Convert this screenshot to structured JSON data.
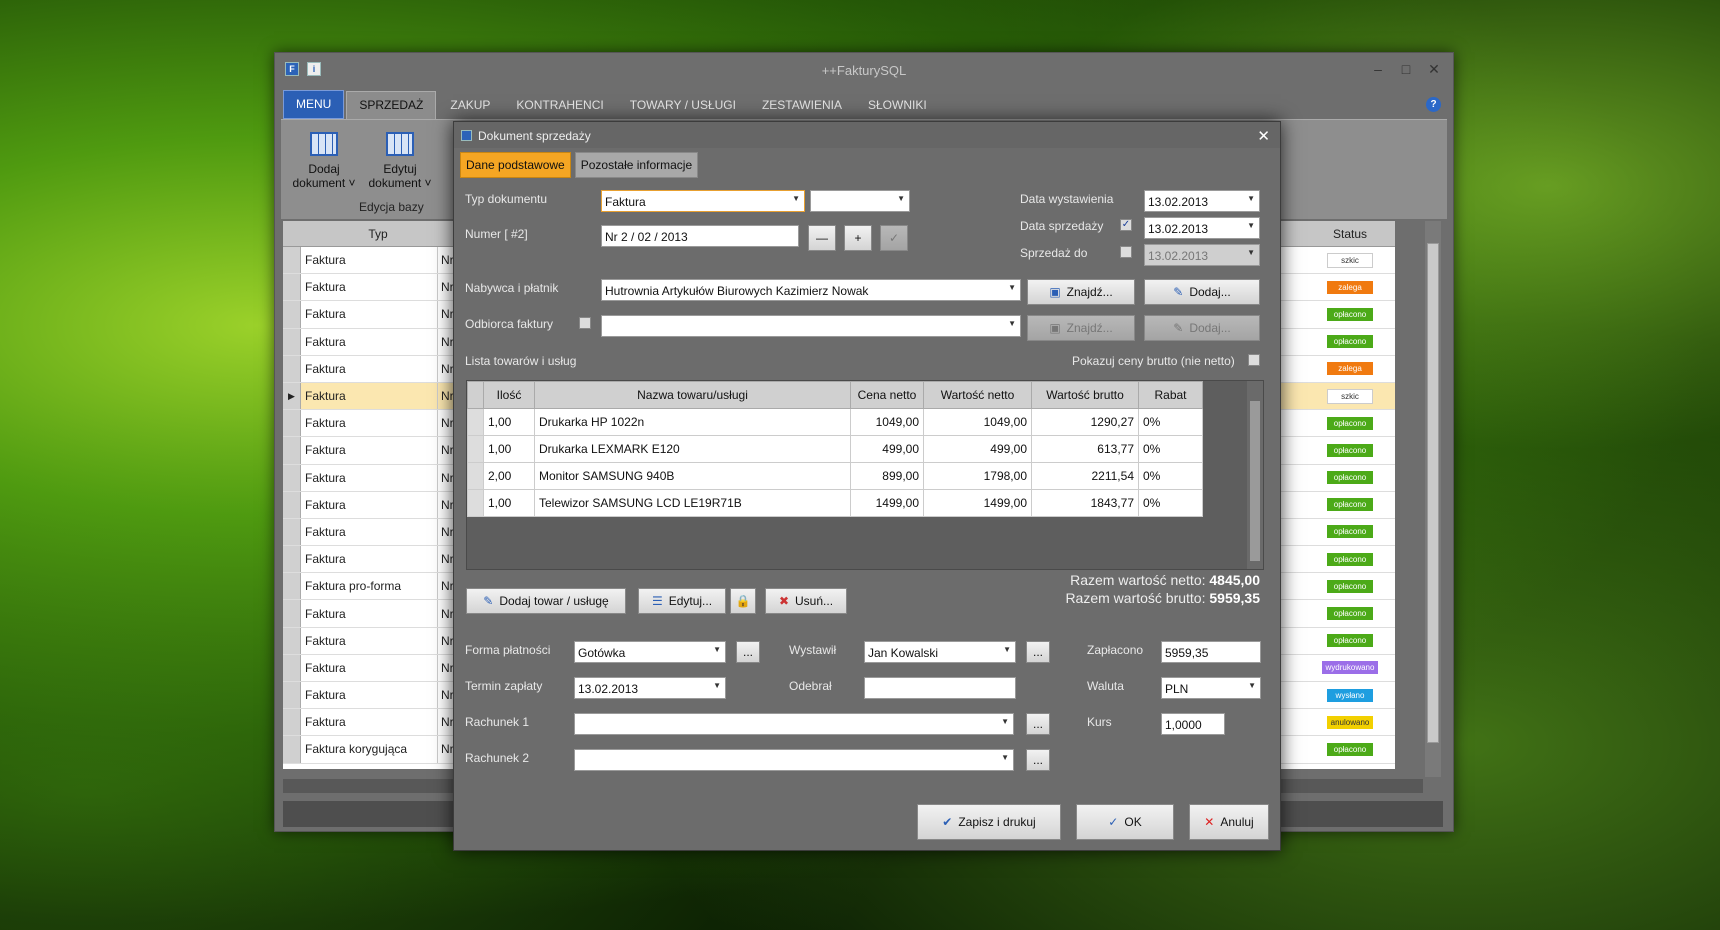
{
  "app": {
    "title": "++FakturySQL"
  },
  "menu": {
    "items": [
      "MENU",
      "SPRZEDAŻ",
      "ZAKUP",
      "KONTRAHENCI",
      "TOWARY / USŁUGI",
      "ZESTAWIENIA",
      "SŁOWNIKI"
    ]
  },
  "ribbon": {
    "add_doc": "Dodaj\ndokument",
    "edit_doc": "Edytuj\ndokument",
    "group": "Edycja bazy"
  },
  "grid": {
    "col_typ": "Typ",
    "col_status": "Status",
    "rows": [
      {
        "typ": "Faktura",
        "nr": "Nr",
        "status": "szkic",
        "color": "#ffffff"
      },
      {
        "typ": "Faktura",
        "nr": "Nr",
        "status": "zalega",
        "color": "#f07a10"
      },
      {
        "typ": "Faktura",
        "nr": "Nr",
        "status": "opłacono",
        "color": "#4caa18"
      },
      {
        "typ": "Faktura",
        "nr": "Nr",
        "status": "opłacono",
        "color": "#4caa18"
      },
      {
        "typ": "Faktura",
        "nr": "Nr",
        "status": "zalega",
        "color": "#f07a10"
      },
      {
        "typ": "Faktura",
        "nr": "Nr",
        "status": "szkic",
        "color": "#ffffff"
      },
      {
        "typ": "Faktura",
        "nr": "Nr",
        "status": "opłacono",
        "color": "#4caa18"
      },
      {
        "typ": "Faktura",
        "nr": "Nr",
        "status": "opłacono",
        "color": "#4caa18"
      },
      {
        "typ": "Faktura",
        "nr": "Nr",
        "status": "opłacono",
        "color": "#4caa18"
      },
      {
        "typ": "Faktura",
        "nr": "Nr",
        "status": "opłacono",
        "color": "#4caa18"
      },
      {
        "typ": "Faktura",
        "nr": "Nr",
        "status": "opłacono",
        "color": "#4caa18"
      },
      {
        "typ": "Faktura",
        "nr": "Nr",
        "status": "opłacono",
        "color": "#4caa18"
      },
      {
        "typ": "Faktura pro-forma",
        "nr": "Nr",
        "status": "opłacono",
        "color": "#4caa18"
      },
      {
        "typ": "Faktura",
        "nr": "Nr",
        "status": "opłacono",
        "color": "#4caa18"
      },
      {
        "typ": "Faktura",
        "nr": "Nr",
        "status": "opłacono",
        "color": "#4caa18"
      },
      {
        "typ": "Faktura",
        "nr": "Nr",
        "status": "wydrukowano",
        "color": "#9b6ee8"
      },
      {
        "typ": "Faktura",
        "nr": "Nr",
        "status": "wysłano",
        "color": "#1e9ee0"
      },
      {
        "typ": "Faktura",
        "nr": "Nr",
        "status": "anulowano",
        "color": "#f2d000"
      },
      {
        "typ": "Faktura korygująca",
        "nr": "Nr",
        "status": "opłacono",
        "color": "#4caa18"
      }
    ]
  },
  "dialog": {
    "title": "Dokument sprzedaży",
    "tabs": [
      "Dane podstawowe",
      "Pozostałe informacje"
    ],
    "typ_label": "Typ dokumentu",
    "typ_value": "Faktura",
    "numer_label": "Numer [ #2]",
    "numer_value": "Nr 2 / 02 / 2013",
    "data_wyst_label": "Data wystawienia",
    "data_wyst": "13.02.2013",
    "data_sprz_label": "Data sprzedaży",
    "data_sprz": "13.02.2013",
    "sprz_do_label": "Sprzedaż do",
    "sprz_do": "13.02.2013",
    "nabywca_label": "Nabywca i płatnik",
    "nabywca": "Hutrownia Artykułów Biurowych Kazimierz Nowak",
    "odbiorca_label": "Odbiorca faktury",
    "znajdz": "Znajdź...",
    "dodaj": "Dodaj...",
    "lista_label": "Lista towarów i usług",
    "brutto_label": "Pokazuj ceny brutto (nie netto)",
    "cols": [
      "Ilość",
      "Nazwa towaru/usługi",
      "Cena netto",
      "Wartość netto",
      "Wartość brutto",
      "Rabat"
    ],
    "items": [
      [
        "1,00",
        "Drukarka HP 1022n",
        "1049,00",
        "1049,00",
        "1290,27",
        "0%"
      ],
      [
        "1,00",
        "Drukarka LEXMARK E120",
        "499,00",
        "499,00",
        "613,77",
        "0%"
      ],
      [
        "2,00",
        "Monitor SAMSUNG 940B",
        "899,00",
        "1798,00",
        "2211,54",
        "0%"
      ],
      [
        "1,00",
        "Telewizor SAMSUNG LCD LE19R71B",
        "1499,00",
        "1499,00",
        "1843,77",
        "0%"
      ]
    ],
    "razem_netto_label": "Razem wartość netto:",
    "razem_netto": "4845,00",
    "razem_brutto_label": "Razem wartość brutto:",
    "razem_brutto": "5959,35",
    "dodaj_towar": "Dodaj towar / usługę",
    "edytuj": "Edytuj...",
    "usun": "Usuń...",
    "forma_label": "Forma płatności",
    "forma": "Gotówka",
    "termin_label": "Termin zapłaty",
    "termin": "13.02.2013",
    "rach1_label": "Rachunek 1",
    "rach2_label": "Rachunek 2",
    "wystawil_label": "Wystawił",
    "wystawil": "Jan Kowalski",
    "odebral_label": "Odebrał",
    "zaplacono_label": "Zapłacono",
    "zaplacono": "5959,35",
    "waluta_label": "Waluta",
    "waluta": "PLN",
    "kurs_label": "Kurs",
    "kurs": "1,0000",
    "ellipsis": "...",
    "zapisz": "Zapisz i drukuj",
    "ok": "OK",
    "anuluj": "Anuluj"
  }
}
